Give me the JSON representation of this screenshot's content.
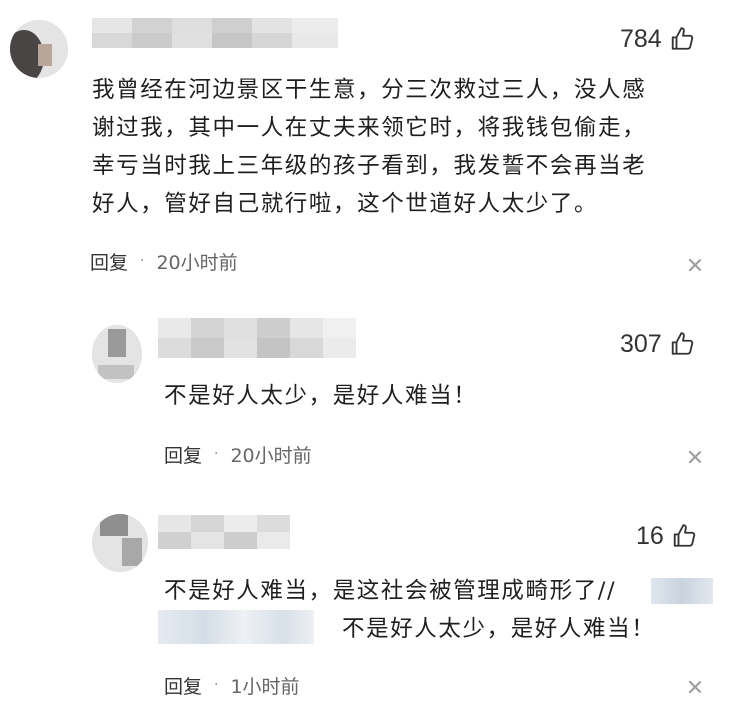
{
  "comments": [
    {
      "likes": "784",
      "text_lines": [
        "我曾经在河边景区干生意，分三次救过三人，没人感",
        "谢过我，其中一人在丈夫来领它时，将我钱包偷走，",
        "幸亏当时我上三年级的孩子看到，我发誓不会再当老",
        "好人，管好自己就行啦，这个世道好人太少了。"
      ],
      "reply_label": "回复",
      "separator": "·",
      "time": "20小时前"
    },
    {
      "likes": "307",
      "text": "不是好人太少，是好人难当！",
      "reply_label": "回复",
      "separator": "·",
      "time": "20小时前"
    },
    {
      "likes": "16",
      "text_line1": "不是好人难当，是这社会被管理成畸形了//",
      "text_line2": "不是好人太少，是好人难当！",
      "reply_label": "回复",
      "separator": "·",
      "time": "1小时前"
    }
  ],
  "icons": {
    "like": "thumbs-up-icon",
    "close": "close-icon"
  },
  "colors": {
    "text": "#1f1f1f",
    "meta": "#666666",
    "mosaic": "#c8c8c8"
  }
}
